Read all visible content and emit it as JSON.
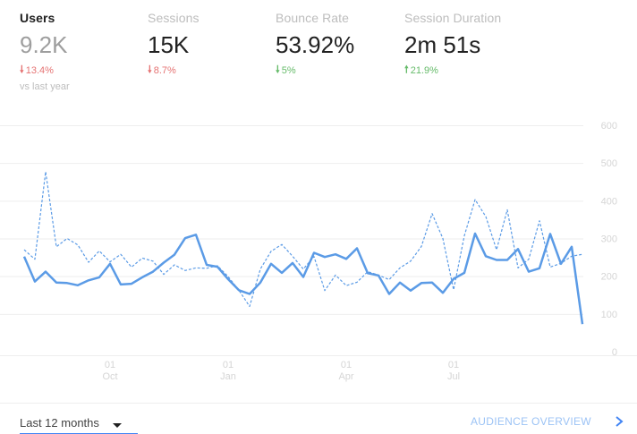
{
  "metrics": [
    {
      "name": "Users",
      "value": "9.2K",
      "delta": "13.4%",
      "direction": "down",
      "sub": "vs last year",
      "selected": true
    },
    {
      "name": "Sessions",
      "value": "15K",
      "delta": "8.7%",
      "direction": "down",
      "sub": "",
      "selected": false
    },
    {
      "name": "Bounce Rate",
      "value": "53.92%",
      "delta": "5%",
      "direction": "down-good",
      "sub": "",
      "selected": false
    },
    {
      "name": "Session Duration",
      "value": "2m 51s",
      "delta": "21.9%",
      "direction": "up",
      "sub": "",
      "selected": false
    }
  ],
  "colors": {
    "current_series": "#5b9be6",
    "previous_series": "#5b9be6",
    "negative": "#e57373",
    "positive": "#66bb6a",
    "grid": "#eeeeee",
    "axis_text": "#d5d5d5",
    "link": "#9cc3f5"
  },
  "chart_data": {
    "type": "line",
    "ylim": [
      0,
      600
    ],
    "yticks": [
      "0",
      "100",
      "200",
      "300",
      "400",
      "500",
      "600"
    ],
    "xticks": [
      {
        "index": 8,
        "day": "01",
        "month": "Oct"
      },
      {
        "index": 19,
        "day": "01",
        "month": "Jan"
      },
      {
        "index": 30,
        "day": "01",
        "month": "Apr"
      },
      {
        "index": 40,
        "day": "01",
        "month": "Jul"
      }
    ],
    "series": [
      {
        "style": "solid",
        "values": [
          252,
          186,
          212,
          183,
          182,
          176,
          189,
          197,
          233,
          178,
          180,
          197,
          212,
          236,
          257,
          301,
          310,
          230,
          225,
          192,
          163,
          153,
          183,
          233,
          209,
          235,
          198,
          262,
          251,
          258,
          246,
          274,
          208,
          202,
          153,
          183,
          162,
          182,
          183,
          156,
          193,
          209,
          313,
          253,
          243,
          243,
          272,
          212,
          221,
          312,
          233,
          278,
          73
        ]
      },
      {
        "style": "dashed",
        "values": [
          270,
          245,
          477,
          278,
          300,
          283,
          237,
          267,
          238,
          258,
          224,
          248,
          240,
          205,
          230,
          215,
          222,
          221,
          228,
          199,
          163,
          120,
          219,
          266,
          284,
          253,
          219,
          252,
          162,
          203,
          175,
          184,
          212,
          203,
          191,
          222,
          240,
          279,
          366,
          300,
          164,
          307,
          403,
          358,
          270,
          376,
          222,
          245,
          347,
          224,
          234,
          253,
          258
        ]
      }
    ]
  },
  "footer": {
    "range_label": "Last 12 months",
    "overview_label": "AUDIENCE OVERVIEW"
  }
}
